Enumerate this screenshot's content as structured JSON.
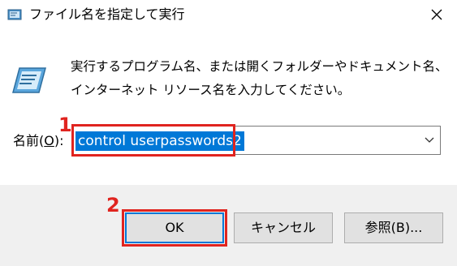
{
  "window": {
    "title": "ファイル名を指定して実行",
    "icon": "run-dialog-icon",
    "close_icon": "close-icon"
  },
  "description": {
    "icon": "run-program-icon",
    "text": "実行するプログラム名、または開くフォルダーやドキュメント名、インターネット リソース名を入力してください。"
  },
  "open_field": {
    "label_prefix": "名前(",
    "label_accesskey": "O",
    "label_suffix": "):",
    "value": "control userpasswords2",
    "dropdown_icon": "chevron-down-icon"
  },
  "buttons": {
    "ok": "OK",
    "cancel": "キャンセル",
    "browse": "参照(B)..."
  },
  "annotations": {
    "step1": "1",
    "step2": "2",
    "highlight_color": "#e0241f"
  },
  "colors": {
    "selection": "#0078d7",
    "footer_bg": "#f0f0f0",
    "button_bg": "#e1e1e1"
  }
}
